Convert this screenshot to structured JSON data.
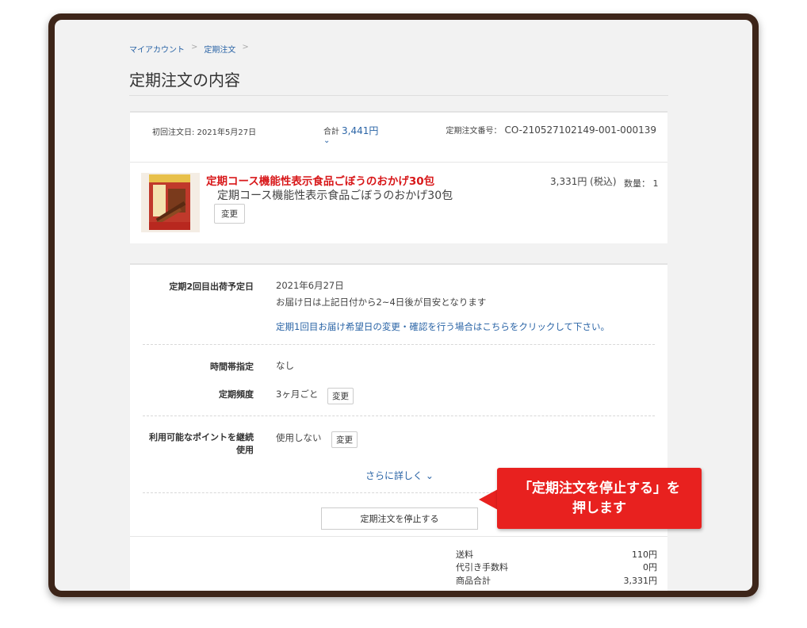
{
  "breadcrumb": {
    "items": [
      "マイアカウント",
      "定期注文"
    ],
    "sep": ">"
  },
  "page_title": "定期注文の内容",
  "summary": {
    "first_order_label": "初回注文日: 2021年5月27日",
    "total_label": "合計",
    "total_amount": "3,441円",
    "order_no_label": "定期注文番号：",
    "order_no": "CO-210527102149-001-000139"
  },
  "product": {
    "title_red": "定期コース機能性表示食品ごぼうのおかげ30包",
    "title": "定期コース機能性表示食品ごぼうのおかげ30包",
    "change_label": "変更",
    "price": "3,331円 (税込)",
    "qty": "数量： 1",
    "image_icon": "product-package-icon"
  },
  "schedule": {
    "ship_label": "定期2回目出荷予定日",
    "ship_date": "2021年6月27日",
    "ship_note": "お届け日は上記日付から2~4日後が目安となります",
    "ship_link": "定期1回目お届け希望日の変更・確認を行う場合はこちらをクリックして下さい。",
    "time_label": "時間帯指定",
    "time_value": "なし",
    "freq_label": "定期頻度",
    "freq_value": "3ヶ月ごと",
    "freq_change": "変更",
    "points_label": "利用可能なポイントを継続使用",
    "points_value": "使用しない",
    "points_change": "変更",
    "more_label": "さらに詳しく ⌄",
    "stop_label": "定期注文を停止する"
  },
  "fees": [
    {
      "label": "送料",
      "value": "110円"
    },
    {
      "label": "代引き手数料",
      "value": "0円"
    },
    {
      "label": "商品合計",
      "value": "3,331円"
    }
  ],
  "callout": {
    "line1": "「定期注文を停止する」を",
    "line2": "押します"
  },
  "colors": {
    "link": "#2a64a6",
    "accent_red": "#e8211f",
    "frame": "#3d2519"
  }
}
